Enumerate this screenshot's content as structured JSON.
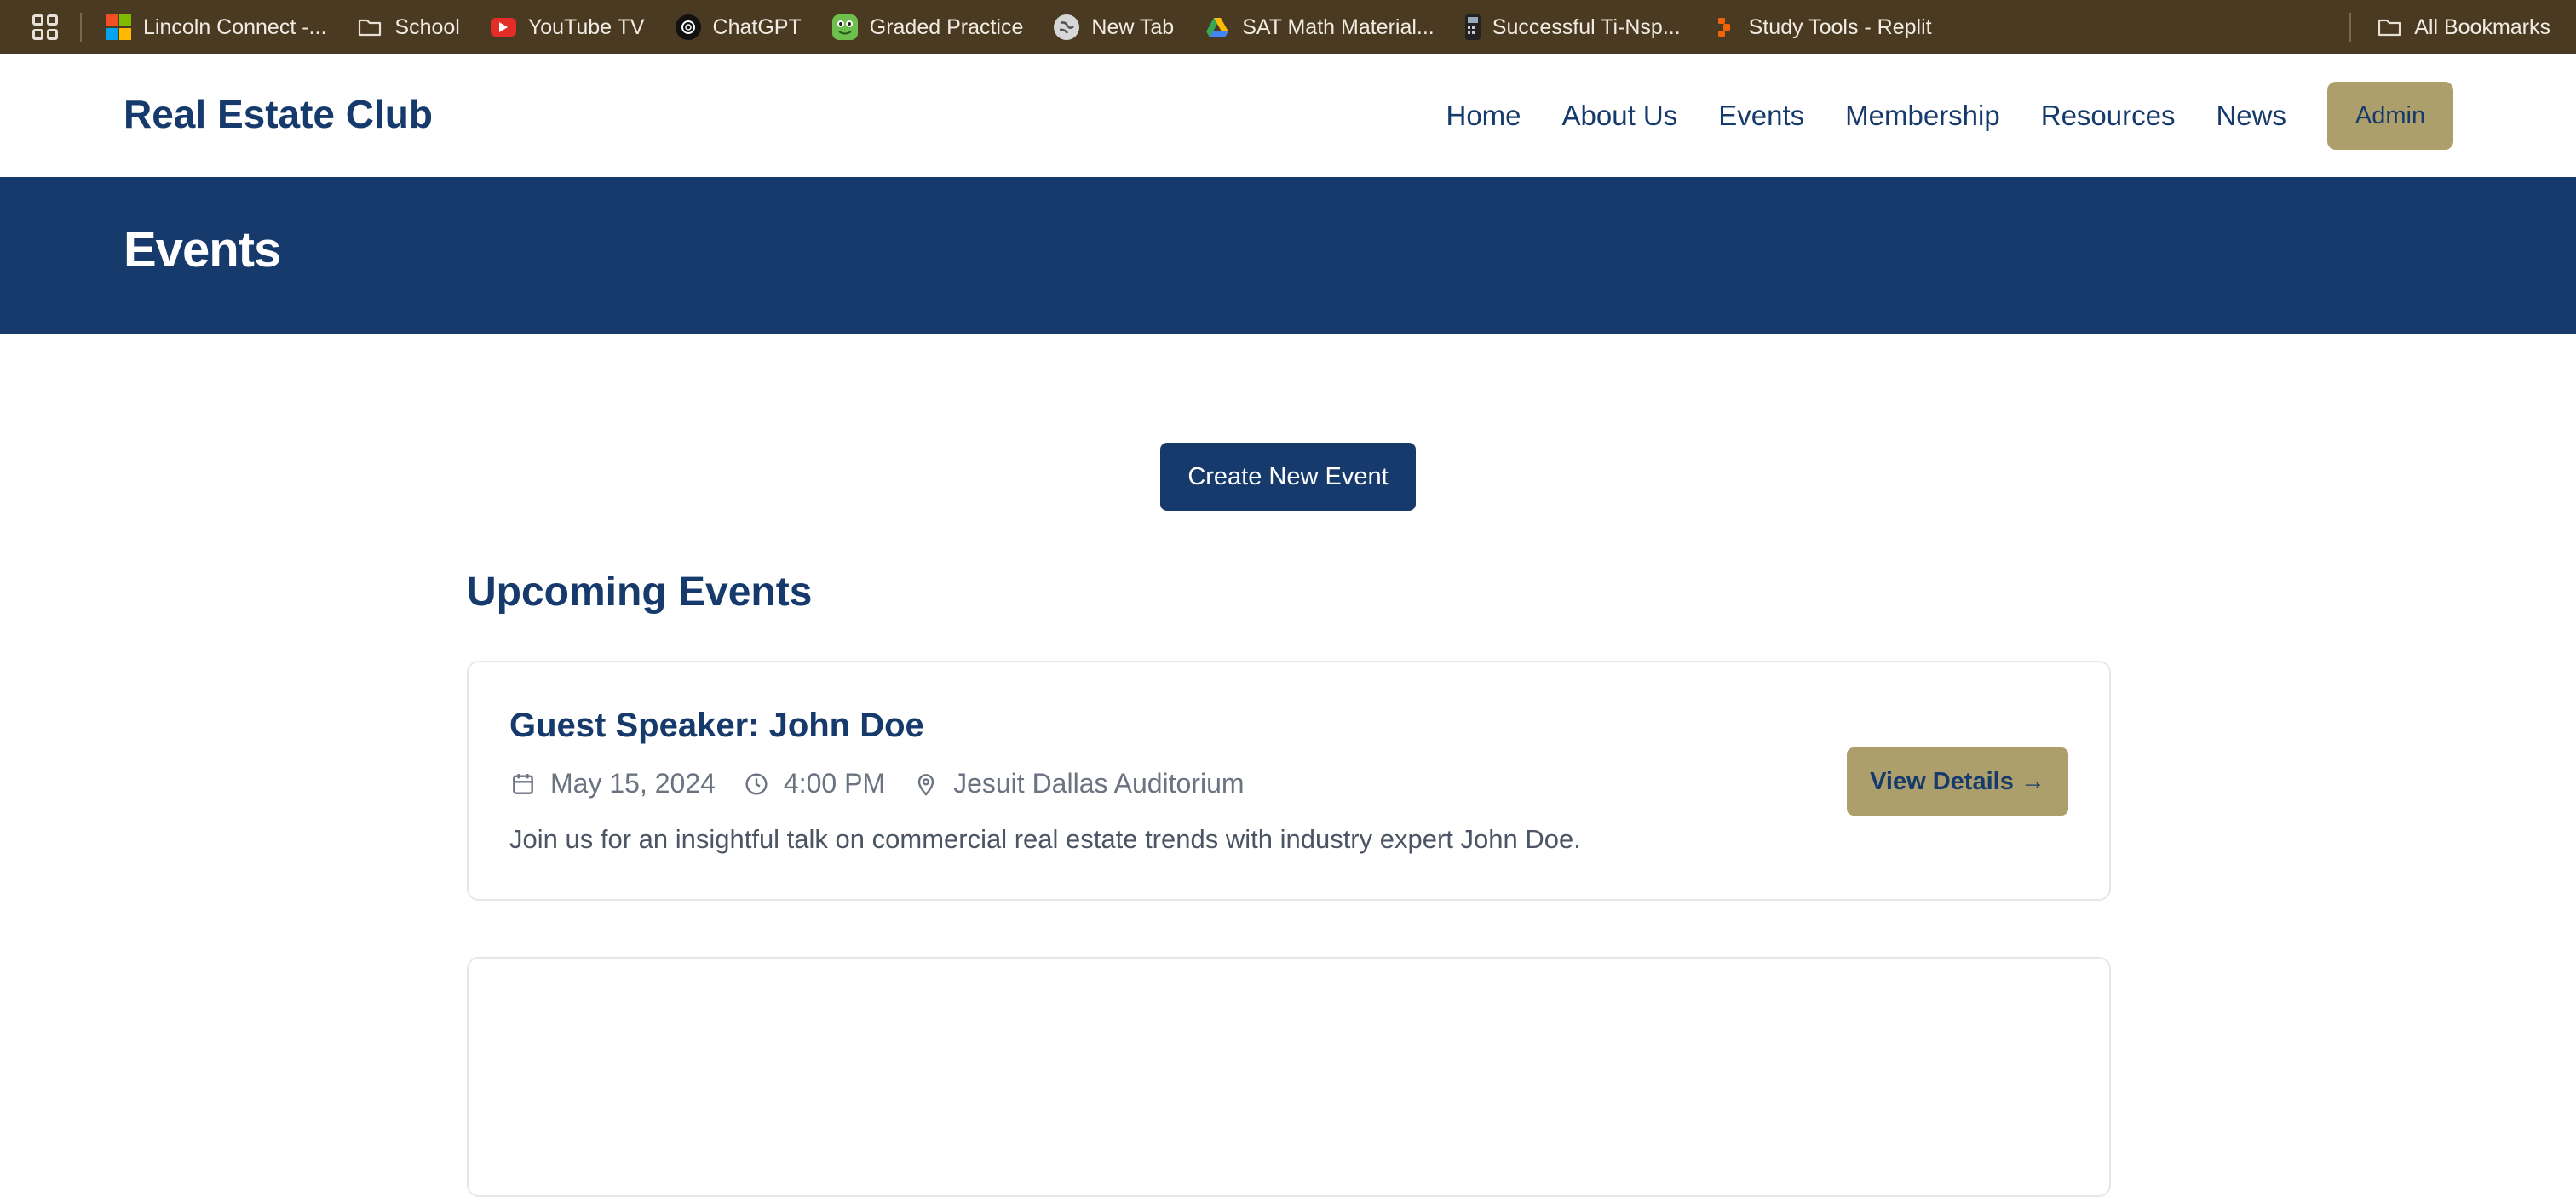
{
  "bookmarks": {
    "items": [
      {
        "label": "Lincoln Connect -...",
        "icon": "microsoft-icon"
      },
      {
        "label": "School",
        "icon": "folder-icon"
      },
      {
        "label": "YouTube TV",
        "icon": "youtube-icon"
      },
      {
        "label": "ChatGPT",
        "icon": "chatgpt-icon"
      },
      {
        "label": "Graded Practice",
        "icon": "frog-icon"
      },
      {
        "label": "New Tab",
        "icon": "globe-icon"
      },
      {
        "label": "SAT Math Material...",
        "icon": "google-drive-icon"
      },
      {
        "label": "Successful Ti-Nsp...",
        "icon": "calculator-icon"
      },
      {
        "label": "Study Tools - Replit",
        "icon": "replit-icon"
      }
    ],
    "all_bookmarks": "All Bookmarks"
  },
  "header": {
    "logo": "Real Estate Club",
    "nav": [
      "Home",
      "About Us",
      "Events",
      "Membership",
      "Resources",
      "News"
    ],
    "admin": "Admin"
  },
  "hero": {
    "title": "Events"
  },
  "main": {
    "create_button": "Create New Event",
    "section_title": "Upcoming Events",
    "events": [
      {
        "title": "Guest Speaker: John Doe",
        "date": "May 15, 2024",
        "time": "4:00 PM",
        "location": "Jesuit Dallas Auditorium",
        "description": "Join us for an insightful talk on commercial real estate trends with industry expert John Doe.",
        "button": "View Details →"
      }
    ]
  },
  "colors": {
    "primary": "#163a6b",
    "accent": "#ac9f6c",
    "bookmarks_bar": "#4b3a22"
  }
}
